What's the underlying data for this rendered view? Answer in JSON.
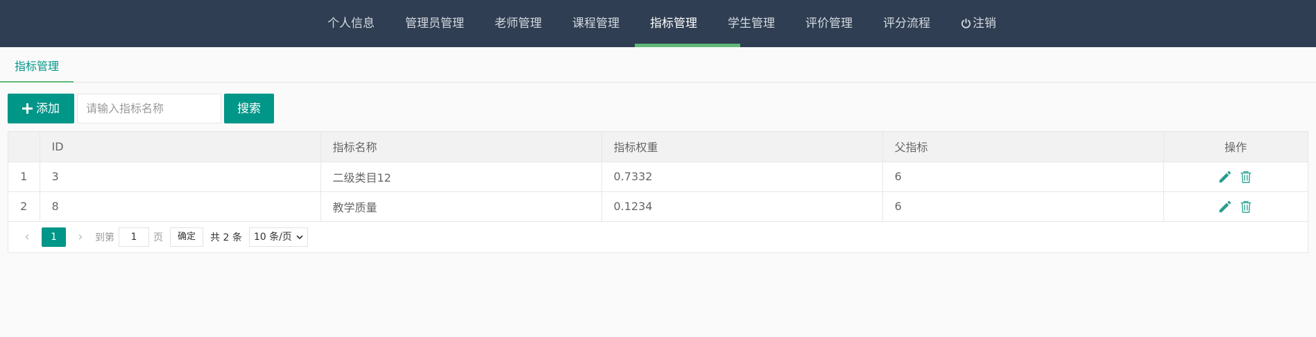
{
  "nav": {
    "items": [
      {
        "label": "个人信息"
      },
      {
        "label": "管理员管理"
      },
      {
        "label": "老师管理"
      },
      {
        "label": "课程管理"
      },
      {
        "label": "指标管理",
        "active": true
      },
      {
        "label": "学生管理"
      },
      {
        "label": "评价管理"
      },
      {
        "label": "评分流程"
      },
      {
        "label": "注销",
        "icon": "power-icon"
      }
    ],
    "accent": "#5fb878",
    "background": "#2f3e52"
  },
  "tab": {
    "label": "指标管理"
  },
  "toolbar": {
    "add_label": "添加",
    "add_icon": "plus-icon",
    "search_placeholder": "请输入指标名称",
    "search_value": "",
    "search_label": "搜索"
  },
  "table": {
    "columns": [
      "",
      "ID",
      "指标名称",
      "指标权重",
      "父指标",
      "操作"
    ],
    "rows": [
      {
        "num": "1",
        "id": "3",
        "name": "二级类目12",
        "weight": "0.7332",
        "parent": "6"
      },
      {
        "num": "2",
        "id": "8",
        "name": "教学质量",
        "weight": "0.1234",
        "parent": "6"
      }
    ],
    "row_actions": [
      "edit-icon",
      "delete-icon"
    ]
  },
  "pager": {
    "current_page": "1",
    "goto_label": "到第",
    "goto_value": "1",
    "page_unit": "页",
    "confirm_label": "确定",
    "total_label": "共 2 条",
    "page_size_label": "10 条/页"
  },
  "colors": {
    "primary": "#009688"
  }
}
